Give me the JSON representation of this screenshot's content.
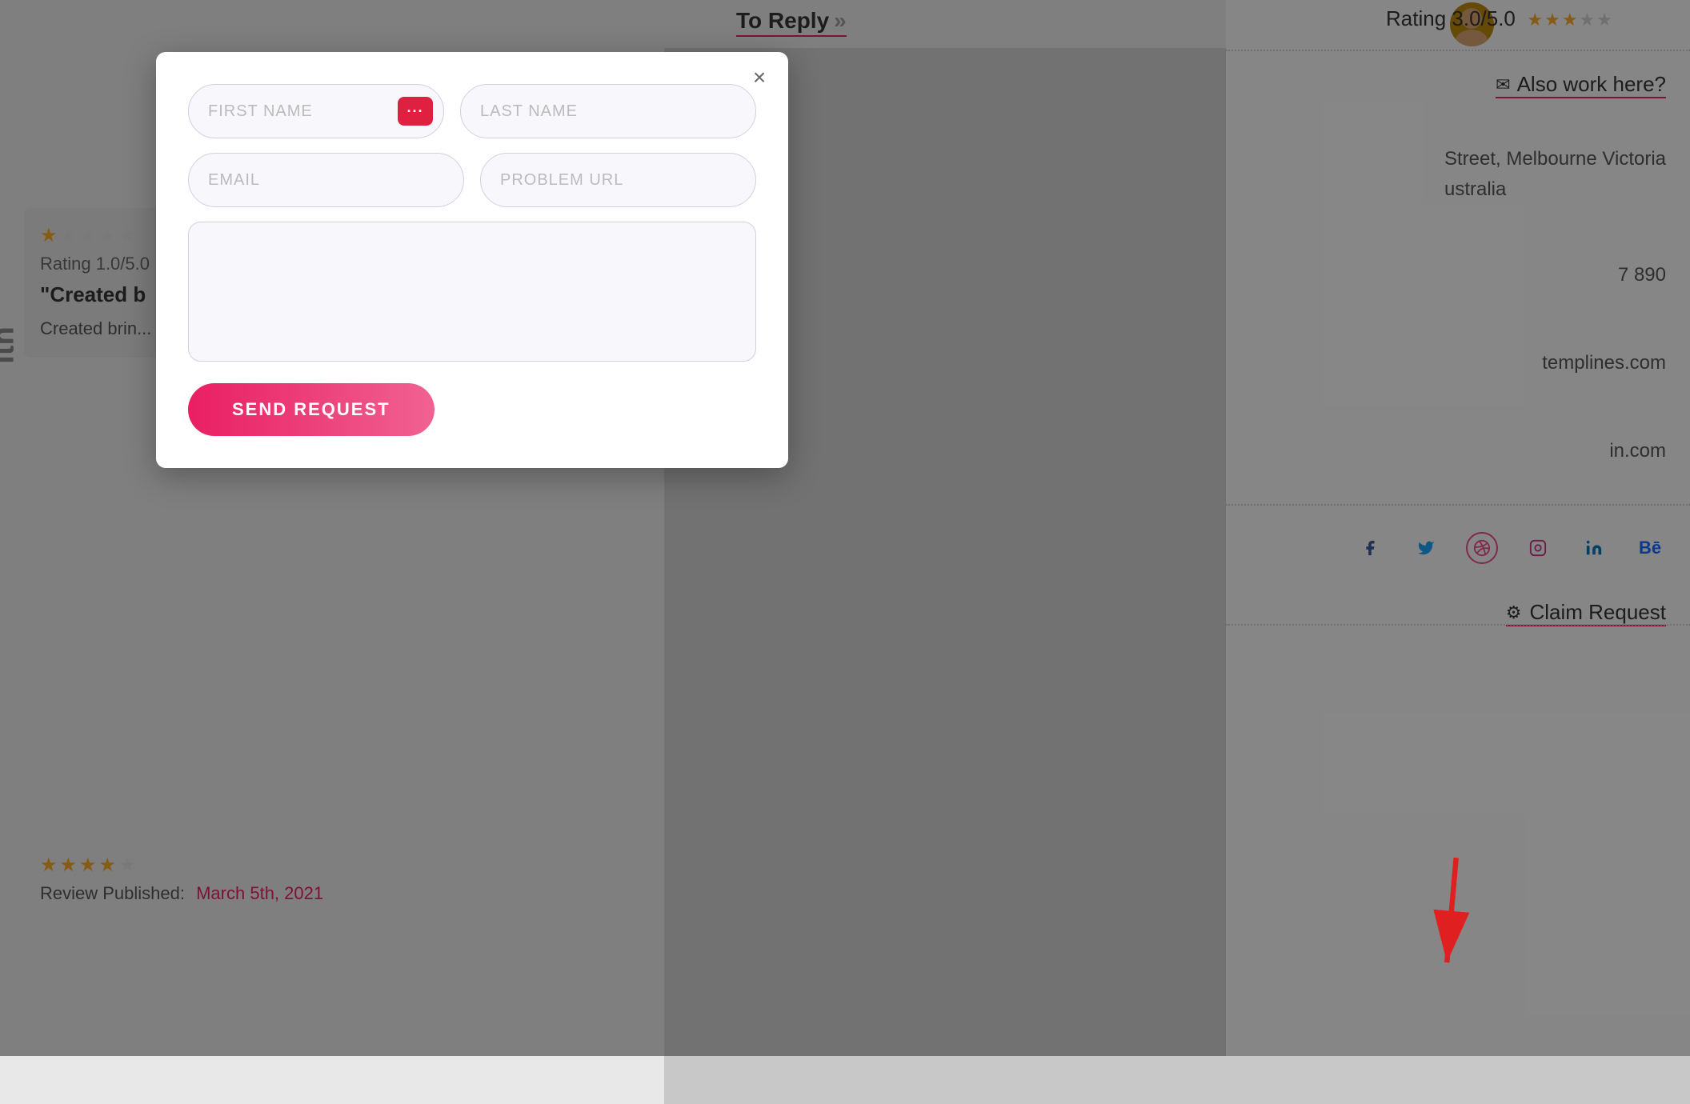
{
  "background": {
    "color": "#d0d0d0"
  },
  "top_bar": {
    "to_reply_label": "To Reply",
    "to_reply_chevron": "»"
  },
  "right_sidebar": {
    "rating_label": "Rating 3.0/5.0",
    "rating_value": "3.0/5.0",
    "also_work_label": "Also work here?",
    "address_line1": "Street, Melbourne Victoria",
    "address_line2": "ustralia",
    "phone": "7 890",
    "website": "templines.com",
    "linkedin": "in.com",
    "claim_request_label": "Claim Request",
    "social_icons": [
      "facebook",
      "twitter",
      "dribbble",
      "instagram",
      "linkedin",
      "behance"
    ]
  },
  "review_card": {
    "rating": "Rating 1.0/5.0",
    "title": "\"Created b",
    "text_preview": "Created brin... divide cattle ... created even",
    "bottom_review_published": "Review Published:",
    "bottom_review_date": "March 5th, 2021"
  },
  "modal": {
    "close_label": "×",
    "first_name_placeholder": "FIRST NAME",
    "last_name_placeholder": "LAST NAME",
    "email_placeholder": "EMAIL",
    "problem_url_placeholder": "PROBLEM URL",
    "message_placeholder": "",
    "send_button_label": "SEND REQUEST",
    "icon_dots": "···"
  },
  "rotated_text": "ith"
}
